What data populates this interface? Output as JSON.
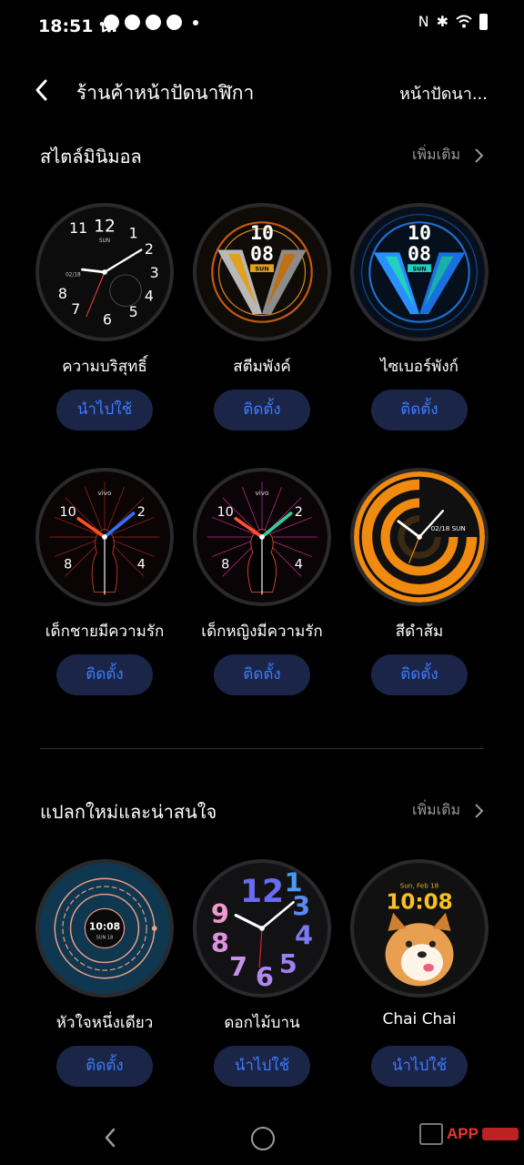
{
  "status_bar": {
    "time": "18:51 น.",
    "icons": [
      "nfc-icon",
      "bluetooth-icon",
      "wifi-icon",
      "battery-icon"
    ]
  },
  "header": {
    "title": "ร้านค้าหน้าปัดนาฬิกา",
    "right_link": "หน้าปัดนา..."
  },
  "sections": [
    {
      "title": "สไตล์มินิมอล",
      "more_label": "เพิ่มเติม",
      "items": [
        {
          "name": "ความบริสุทธิ์",
          "action": "นำไปใช้",
          "face_text": {
            "top": "12",
            "sub": "SUN",
            "date": "02/18"
          }
        },
        {
          "name": "สตีมพังค์",
          "action": "ติดตั้ง",
          "face_text": {
            "h": "10",
            "m": "08",
            "day": "SUN"
          }
        },
        {
          "name": "ไซเบอร์พังก์",
          "action": "ติดตั้ง",
          "face_text": {
            "h": "10",
            "m": "08",
            "day": "SUN"
          }
        },
        {
          "name": "เด็กชายมีความรัก",
          "action": "ติดตั้ง",
          "face_text": {
            "brand": "vivo",
            "n10": "10",
            "n2": "2",
            "n8": "8",
            "n4": "4"
          }
        },
        {
          "name": "เด็กหญิงมีความรัก",
          "action": "ติดตั้ง",
          "face_text": {
            "brand": "vivo",
            "n10": "10",
            "n2": "2",
            "n8": "8",
            "n4": "4"
          }
        },
        {
          "name": "สีดำส้ม",
          "action": "ติดตั้ง",
          "face_text": {
            "date": "02/18 SUN"
          }
        }
      ]
    },
    {
      "title": "แปลกใหม่และน่าสนใจ",
      "more_label": "เพิ่มเติม",
      "items": [
        {
          "name": "หัวใจหนึ่งเดียว",
          "action": "ติดตั้ง",
          "face_text": {
            "time": "10:08",
            "date": "SUN 18"
          }
        },
        {
          "name": "ดอกไม้บาน",
          "action": "นำไปใช้",
          "face_text": {
            "nums": "12"
          }
        },
        {
          "name": "Chai Chai",
          "action": "นำไปใช้",
          "face_text": {
            "date": "Sun, Feb 18",
            "time": "10:08"
          }
        }
      ]
    }
  ],
  "watermark": {
    "text": "APP"
  },
  "colors": {
    "background": "#000000",
    "button_bg": "#1a2548",
    "button_text": "#3d7bff",
    "muted": "#9a9a9a",
    "accent_orange": "#f08a10"
  }
}
